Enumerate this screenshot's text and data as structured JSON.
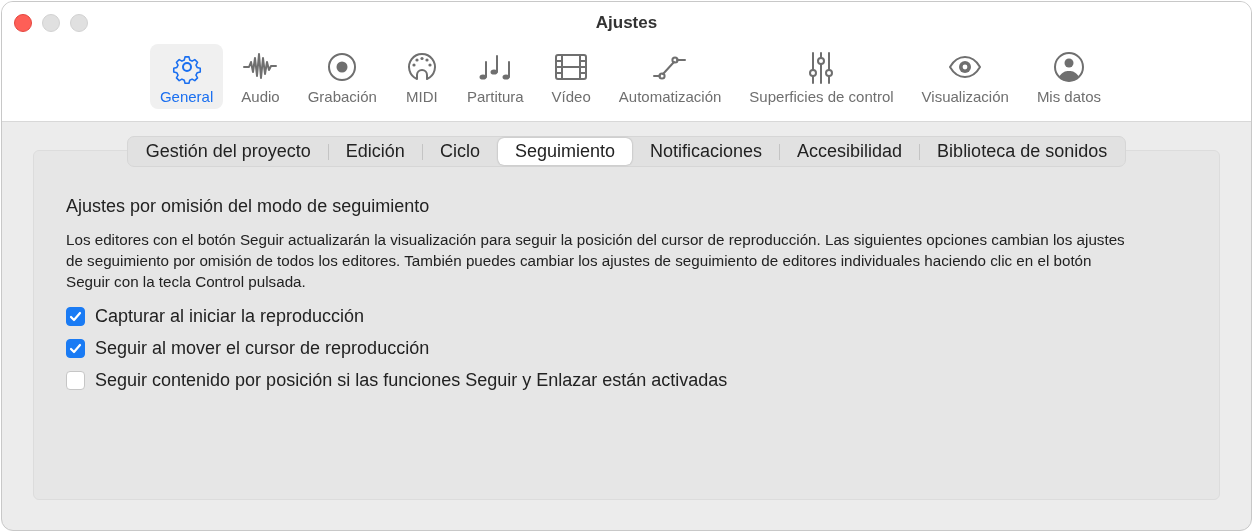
{
  "window": {
    "title": "Ajustes"
  },
  "toolbar": [
    {
      "label": "General",
      "kind": "gear",
      "selected": true
    },
    {
      "label": "Audio",
      "kind": "wave",
      "selected": false
    },
    {
      "label": "Grabación",
      "kind": "record",
      "selected": false
    },
    {
      "label": "MIDI",
      "kind": "midi",
      "selected": false
    },
    {
      "label": "Partitura",
      "kind": "notes",
      "selected": false
    },
    {
      "label": "Vídeo",
      "kind": "film",
      "selected": false
    },
    {
      "label": "Automatización",
      "kind": "automation",
      "selected": false
    },
    {
      "label": "Superficies de control",
      "kind": "faders",
      "selected": false
    },
    {
      "label": "Visualización",
      "kind": "eye",
      "selected": false
    },
    {
      "label": "Mis datos",
      "kind": "person",
      "selected": false
    }
  ],
  "tabs": [
    {
      "label": "Gestión del proyecto",
      "selected": false
    },
    {
      "label": "Edición",
      "selected": false
    },
    {
      "label": "Ciclo",
      "selected": false
    },
    {
      "label": "Seguimiento",
      "selected": true
    },
    {
      "label": "Notificaciones",
      "selected": false
    },
    {
      "label": "Accesibilidad",
      "selected": false
    },
    {
      "label": "Biblioteca de sonidos",
      "selected": false
    }
  ],
  "section": {
    "heading": "Ajustes por omisión del modo de seguimiento",
    "description": "Los editores con el botón Seguir actualizarán la visualización para seguir la posición del cursor de reproducción. Las siguientes opciones cambian los ajustes de seguimiento por omisión de todos los editores. También puedes cambiar los ajustes de seguimiento de editores individuales haciendo clic en el botón Seguir con la tecla Control pulsada.",
    "options": [
      {
        "label": "Capturar al iniciar la reproducción",
        "checked": true
      },
      {
        "label": "Seguir al mover el cursor de reproducción",
        "checked": true
      },
      {
        "label": "Seguir contenido por posición si las funciones Seguir y Enlazar están activadas",
        "checked": false
      }
    ]
  }
}
